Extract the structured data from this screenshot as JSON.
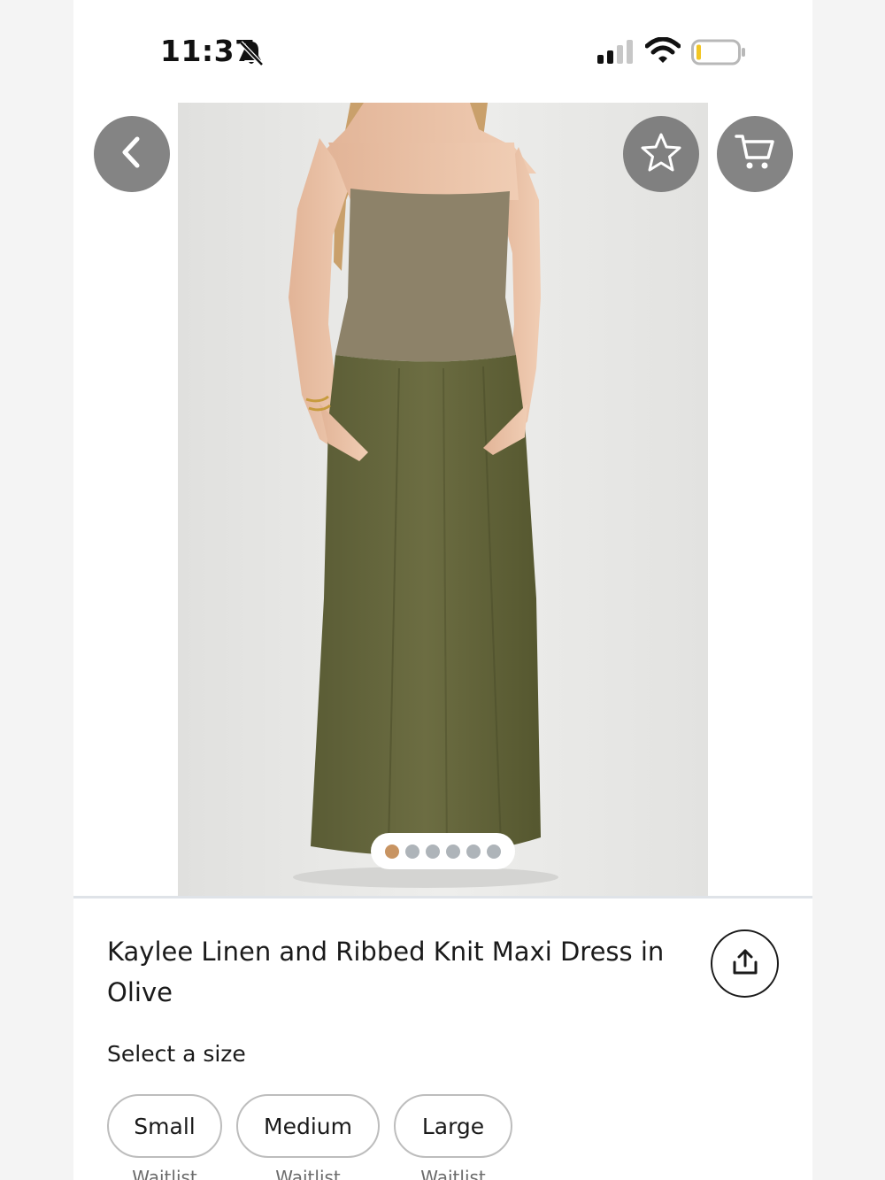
{
  "status_bar": {
    "time": "11:37",
    "icons": [
      "bell-slash-icon",
      "cellular-signal-icon",
      "wifi-icon",
      "battery-low-icon"
    ]
  },
  "product": {
    "image_count": 6,
    "active_image_index": 0,
    "title": "Kaylee Linen and Ribbed Knit Maxi Dress in Olive"
  },
  "actions": {
    "back_icon": "chevron-left-icon",
    "favorite_icon": "star-icon",
    "cart_icon": "cart-icon",
    "share_icon": "share-icon"
  },
  "sizes": {
    "label": "Select a size",
    "options": [
      {
        "name": "Small",
        "status": "Waitlist"
      },
      {
        "name": "Medium",
        "status": "Waitlist"
      },
      {
        "name": "Large",
        "status": "Waitlist"
      }
    ]
  },
  "colors": {
    "active_dot": "#c89462",
    "inactive_dot": "#aeb4b9",
    "overlay_button": "#6e6e6e"
  }
}
